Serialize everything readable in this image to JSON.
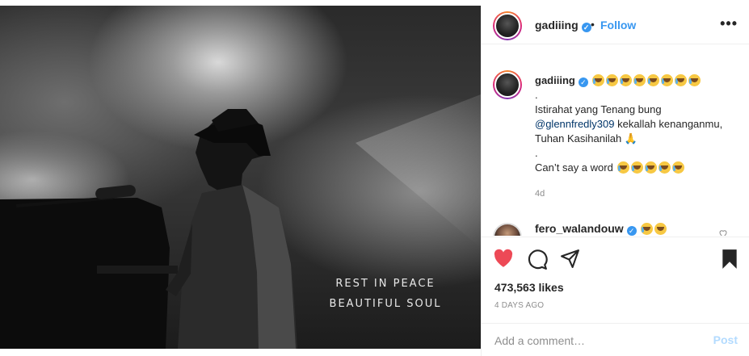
{
  "header": {
    "username": "gadiiing",
    "verified_icon": "verified-badge-icon",
    "separator": "•",
    "follow_label": "Follow",
    "more_label": "•••"
  },
  "photo": {
    "line1": "REST IN PEACE",
    "line2": "BEAUTIFUL SOUL"
  },
  "caption": {
    "username": "gadiiing",
    "dot1": ".",
    "line1": "Istirahat yang Tenang bung",
    "mention": "@glennfredly309",
    "line2_rest": " kekallah kenanganmu, Tuhan Kasihanilah",
    "dot2": ".",
    "line3": "Can’t say a word",
    "age": "4d"
  },
  "reply": {
    "username": "fero_walandouw"
  },
  "actions": {
    "likes": "473,563 likes",
    "posted_ago": "4 DAYS AGO"
  },
  "comment_box": {
    "placeholder": "Add a comment…",
    "post_label": "Post"
  },
  "colors": {
    "accent": "#3897f0",
    "like_red": "#ed4956",
    "post_disabled": "#b3dbff"
  }
}
